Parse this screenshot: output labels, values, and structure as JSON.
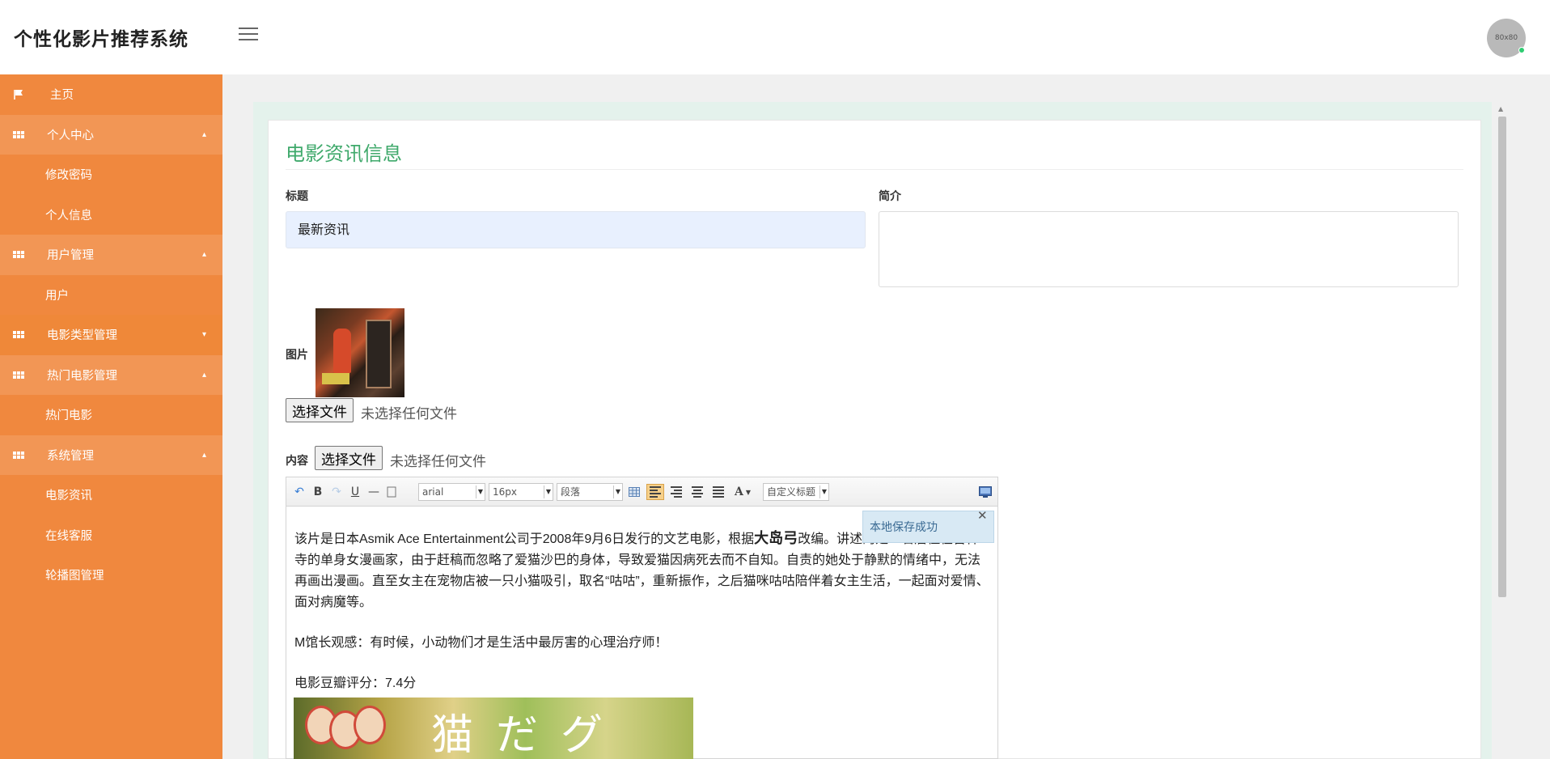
{
  "header": {
    "brand": "个性化影片推荐系统",
    "avatar_text": "80x80"
  },
  "sidebar": {
    "items": [
      {
        "label": "主页",
        "type": "home"
      },
      {
        "label": "个人中心",
        "type": "parent",
        "expanded": true
      },
      {
        "label": "修改密码",
        "type": "child"
      },
      {
        "label": "个人信息",
        "type": "child"
      },
      {
        "label": "用户管理",
        "type": "parent",
        "expanded": true
      },
      {
        "label": "用户",
        "type": "child"
      },
      {
        "label": "电影类型管理",
        "type": "parent",
        "expanded": false
      },
      {
        "label": "热门电影管理",
        "type": "parent",
        "expanded": true
      },
      {
        "label": "热门电影",
        "type": "child"
      },
      {
        "label": "系统管理",
        "type": "parent",
        "expanded": true
      },
      {
        "label": "电影资讯",
        "type": "child"
      },
      {
        "label": "在线客服",
        "type": "child"
      },
      {
        "label": "轮播图管理",
        "type": "child"
      }
    ]
  },
  "form": {
    "heading": "电影资讯信息",
    "title_label": "标题",
    "title_value": "最新资讯",
    "desc_label": "简介",
    "desc_value": "",
    "image_label": "图片",
    "content_label": "内容",
    "file_button": "选择文件",
    "no_file": "未选择任何文件"
  },
  "editor": {
    "font_family": "arial",
    "font_size": "16px",
    "paragraph": "段落",
    "custom_heading": "自定义标题",
    "save_tip": "本地保存成功",
    "para1_a": "该片是日本Asmik Ace Entertainment公司于2008年9月6日发行的文艺电影，根据",
    "para1_bold": "大岛弓",
    "para1_b": "改编。讲述的是一名居住在吉祥寺的单身女漫画家，由于赶稿而忽略了爱猫沙巴的身体，导致爱猫因病死去而不自知。自责的她处于静默的情绪中，无法再画出漫画。直至女主在宠物店被一只小猫吸引，取名“咕咕”，重新振作，之后猫咪咕咕陪伴着女主生活，一起面对爱情、面对病魔等。",
    "para2": "M馆长观感：有时候，小动物们才是生活中最厉害的心理治疗师！",
    "para3": "电影豆瓣评分：7.4分",
    "image_glyphs": "猫 だ グ"
  },
  "colors": {
    "sidebar": "#f0883e",
    "accent_title": "#3fa96b",
    "input_bg": "#e8f0fe",
    "main_frame": "#e4f2ec"
  },
  "icons": {
    "home": "flag-icon",
    "section": "grid-icon",
    "menu": "hamburger-icon"
  }
}
